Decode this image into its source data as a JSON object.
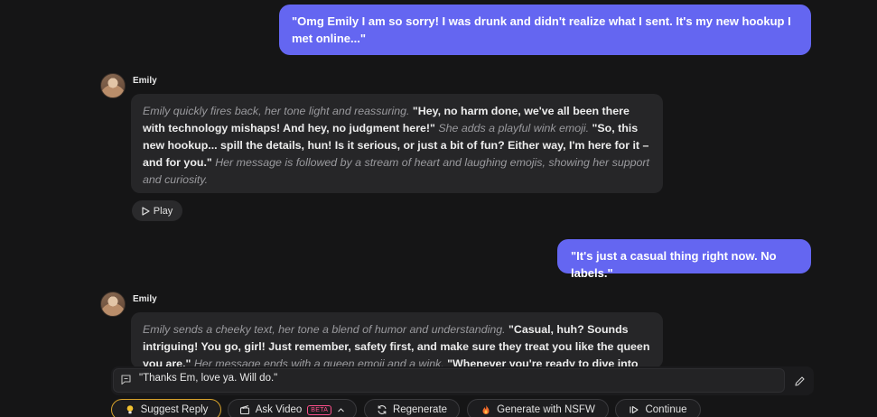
{
  "conversation": {
    "user_message_1": "\"Omg Emily I am so sorry! I was drunk and didn't realize what I sent. It's my new hookup I met online...\"",
    "bot_name_1": "Emily",
    "bot_message_1": {
      "n1": "Emily quickly fires back, her tone light and reassuring.",
      "s1": " \"Hey, no harm done, we've all been there with technology mishaps! And hey, no judgment here!\" ",
      "n2": "She adds a playful wink emoji.",
      "s2": " \"So, this new hookup... spill the details, hun! Is it serious, or just a bit of fun? Either way, I'm here for it – and for you.\" ",
      "n3": "Her message is followed by a stream of heart and laughing emojis, showing her support and curiosity."
    },
    "play_label": "Play",
    "user_message_2": "\"It's just a casual thing right now. No labels.\"",
    "bot_name_2": "Emily",
    "bot_message_2": {
      "n1": "Emily sends a cheeky text, her tone a blend of humor and understanding.",
      "s1": " \"Casual, huh? Sounds intriguing! You go, girl! Just remember, safety first, and make sure they treat you like the queen you are.\" ",
      "n2": "Her message ends with a queen emoji and a wink.",
      "s2": " \"Whenever you're ready to dive into"
    }
  },
  "composer": {
    "value": "\"Thanks Em, love ya. Will do.\""
  },
  "actions": {
    "suggest_reply": "Suggest Reply",
    "ask_video": "Ask Video",
    "beta_badge": "BETA",
    "regenerate": "Regenerate",
    "generate_nsfw": "Generate with NSFW",
    "continue": "Continue"
  },
  "colors": {
    "user_bubble": "#6466f1",
    "bot_bubble": "#262628",
    "background": "#151516",
    "suggest_border": "#d7a22b",
    "beta": "#ff4f8b"
  },
  "icons": [
    "play-icon",
    "chat-icon",
    "pencil-icon",
    "lightbulb-icon",
    "clapperboard-icon",
    "chevron-up-icon",
    "refresh-icon",
    "flame-icon",
    "skip-forward-icon"
  ]
}
